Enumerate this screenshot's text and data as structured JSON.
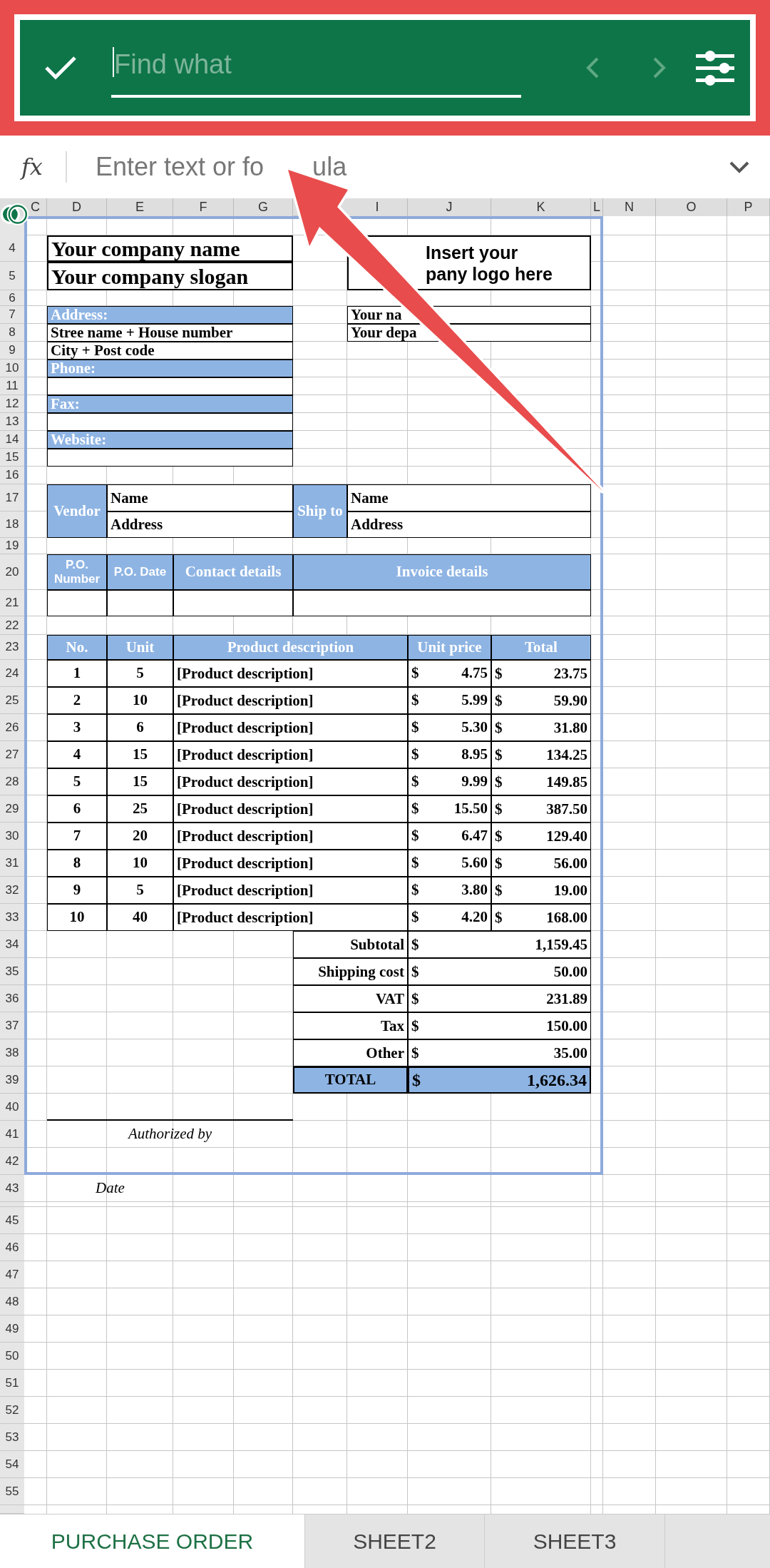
{
  "find_bar": {
    "placeholder": "Find what"
  },
  "formula_bar": {
    "label": "fx",
    "placeholder_parts": [
      "Enter text or fo",
      "ula"
    ]
  },
  "sheet": {
    "column_headers": [
      "C",
      "D",
      "E",
      "F",
      "G",
      "I",
      "J",
      "K",
      "L",
      "N",
      "O",
      "P"
    ],
    "row_numbers": [
      "4",
      "5",
      "6",
      "7",
      "8",
      "9",
      "10",
      "11",
      "12",
      "13",
      "14",
      "15",
      "16",
      "17",
      "18",
      "19",
      "20",
      "21",
      "22",
      "23",
      "24",
      "25",
      "26",
      "27",
      "28",
      "29",
      "30",
      "31",
      "32",
      "33",
      "34",
      "35",
      "36",
      "37",
      "38",
      "39",
      "40",
      "41",
      "42",
      "43",
      "45",
      "46",
      "47",
      "48",
      "49",
      "50",
      "51",
      "52",
      "53",
      "54",
      "55"
    ],
    "company": {
      "name": "Your company name",
      "slogan": "Your company slogan"
    },
    "logo_box": {
      "lines": [
        "Insert your",
        "pany logo here"
      ]
    },
    "contact_rows": [
      {
        "kind": "label",
        "text": "Address:"
      },
      {
        "kind": "value",
        "text": "Stree name + House number"
      },
      {
        "kind": "value",
        "text": "City + Post code"
      },
      {
        "kind": "label",
        "text": "Phone:"
      },
      {
        "kind": "blank"
      },
      {
        "kind": "label",
        "text": "Fax:"
      },
      {
        "kind": "blank"
      },
      {
        "kind": "label",
        "text": "Website:"
      },
      {
        "kind": "blank"
      }
    ],
    "person_rows": [
      "Your na",
      "Your depa"
    ],
    "parties": [
      {
        "label": "Vendor",
        "name": "Name",
        "address": "Address"
      },
      {
        "label": "Ship to",
        "name": "Name",
        "address": "Address"
      }
    ],
    "po_headers": [
      "P.O. Number",
      "P.O. Date",
      "Contact details",
      "Invoice details"
    ],
    "item_columns": [
      "No.",
      "Unit",
      "Product description",
      "Unit price",
      "Total"
    ],
    "items": [
      {
        "no": "1",
        "unit": "5",
        "description": "[Product description]",
        "price_currency": "$",
        "price": "4.75",
        "total_currency": "$",
        "total": "23.75"
      },
      {
        "no": "2",
        "unit": "10",
        "description": "[Product description]",
        "price_currency": "$",
        "price": "5.99",
        "total_currency": "$",
        "total": "59.90"
      },
      {
        "no": "3",
        "unit": "6",
        "description": "[Product description]",
        "price_currency": "$",
        "price": "5.30",
        "total_currency": "$",
        "total": "31.80"
      },
      {
        "no": "4",
        "unit": "15",
        "description": "[Product description]",
        "price_currency": "$",
        "price": "8.95",
        "total_currency": "$",
        "total": "134.25"
      },
      {
        "no": "5",
        "unit": "15",
        "description": "[Product description]",
        "price_currency": "$",
        "price": "9.99",
        "total_currency": "$",
        "total": "149.85"
      },
      {
        "no": "6",
        "unit": "25",
        "description": "[Product description]",
        "price_currency": "$",
        "price": "15.50",
        "total_currency": "$",
        "total": "387.50"
      },
      {
        "no": "7",
        "unit": "20",
        "description": "[Product description]",
        "price_currency": "$",
        "price": "6.47",
        "total_currency": "$",
        "total": "129.40"
      },
      {
        "no": "8",
        "unit": "10",
        "description": "[Product description]",
        "price_currency": "$",
        "price": "5.60",
        "total_currency": "$",
        "total": "56.00"
      },
      {
        "no": "9",
        "unit": "5",
        "description": "[Product description]",
        "price_currency": "$",
        "price": "3.80",
        "total_currency": "$",
        "total": "19.00"
      },
      {
        "no": "10",
        "unit": "40",
        "description": "[Product description]",
        "price_currency": "$",
        "price": "4.20",
        "total_currency": "$",
        "total": "168.00"
      }
    ],
    "totals": [
      {
        "kind": "line",
        "label": "Subtotal",
        "currency": "$",
        "value": "1,159.45"
      },
      {
        "kind": "line",
        "label": "Shipping cost",
        "currency": "$",
        "value": "50.00"
      },
      {
        "kind": "line",
        "label": "VAT",
        "currency": "$",
        "value": "231.89"
      },
      {
        "kind": "line",
        "label": "Tax",
        "currency": "$",
        "value": "150.00"
      },
      {
        "kind": "line",
        "label": "Other",
        "currency": "$",
        "value": "35.00"
      },
      {
        "kind": "grand",
        "label": "TOTAL",
        "currency": "$",
        "value": "1,626.34"
      }
    ],
    "signatures": [
      "Authorized by",
      "Date"
    ]
  },
  "sheet_tabs": [
    {
      "label": "PURCHASE ORDER",
      "selected": true
    },
    {
      "label": "SHEET2",
      "selected": false
    },
    {
      "label": "SHEET3",
      "selected": false
    }
  ]
}
